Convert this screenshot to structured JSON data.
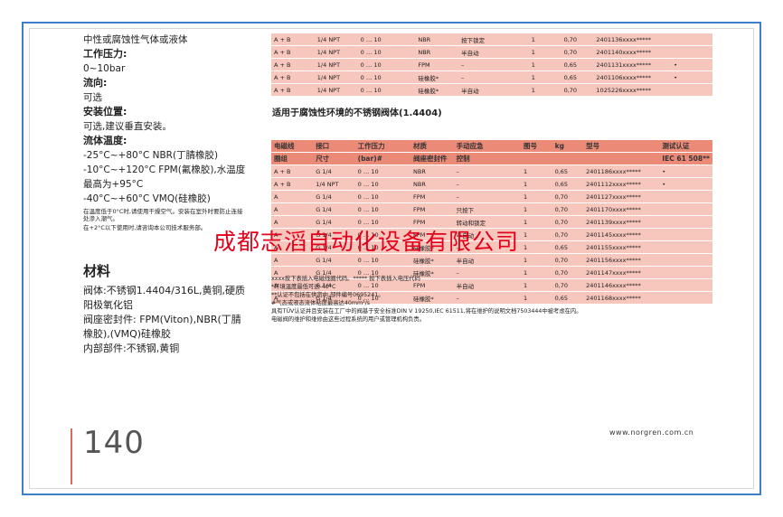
{
  "left": {
    "medium_tail": "中性或腐蚀性气体或液体",
    "pressure_label": "工作压力:",
    "pressure_value": "0~10bar",
    "flow_label": "流向:",
    "flow_value": "可选",
    "install_label": "安装位置:",
    "install_value": "可选,建议垂直安装。",
    "temp_label": "流体温度:",
    "temp_1": "-25°C~+80°C NBR(丁腈橡胶)",
    "temp_2": "-10°C~+120°C FPM(氟橡胶),水温度最高为+95°C",
    "temp_3": "-40°C~+60°C VMQ(硅橡胶)",
    "temp_note1": "在温度低于0°C时,请使用干燥空气。安装在室外时要防止连接处渗入潮气。",
    "temp_note2": "在+2°C以下使用时,请咨询本公司技术服务部。",
    "materials_title": "材料",
    "mat_1": "阀体:不锈钢1.4404/316L,黄铜,硬质阳极氧化铝",
    "mat_2": "阀座密封件: FPM(Viton),NBR(丁腈橡胶),(VMQ)硅橡胶",
    "mat_3": "内部部件:不锈钢,黄铜"
  },
  "table1": {
    "rows": [
      [
        "A + B",
        "1/4 NPT",
        "0 … 10",
        "NBR",
        "按下锁定",
        "1",
        "0,70",
        "2401136xxxx*****",
        ""
      ],
      [
        "A + B",
        "1/4 NPT",
        "0 … 10",
        "NBR",
        "半自动",
        "1",
        "0,70",
        "2401140xxxx*****",
        ""
      ],
      [
        "A + B",
        "1/4 NPT",
        "0 … 10",
        "FPM",
        "–",
        "1",
        "0,65",
        "2401131xxxx*****",
        "•"
      ],
      [
        "A + B",
        "1/4 NPT",
        "0 … 10",
        "硅橡胶*",
        "–",
        "1",
        "0,65",
        "2401106xxxx*****",
        "•"
      ],
      [
        "A + B",
        "1/4 NPT",
        "0 … 10",
        "硅橡胶*",
        "半自动",
        "1",
        "0,70",
        "1025226xxxx*****",
        ""
      ]
    ]
  },
  "section2_title": "适用于腐蚀性环境的不锈钢阀体(1.4404)",
  "table2": {
    "headers_line1": [
      "电磁线",
      "接口",
      "工作压力",
      "材质",
      "手动应急",
      "图号",
      "kg",
      "型号",
      "测试认证"
    ],
    "headers_line2": [
      "圈组",
      "尺寸",
      "(bar)#",
      "阀座密封件",
      "控制",
      "",
      "",
      "",
      "IEC 61 508**"
    ],
    "rows": [
      [
        "A + B",
        "G 1/4",
        "0 … 10",
        "NBR",
        "–",
        "1",
        "0,65",
        "2401186xxxx*****",
        "•"
      ],
      [
        "A + B",
        "1/4 NPT",
        "0 … 10",
        "NBR",
        "–",
        "1",
        "0,65",
        "2401112xxxx*****",
        "•"
      ],
      [
        "A",
        "G 1/4",
        "0 … 10",
        "FPM",
        "–",
        "1",
        "0,70",
        "2401127xxxx*****",
        ""
      ],
      [
        "A",
        "G 1/4",
        "0 … 10",
        "FPM",
        "只按下",
        "1",
        "0,70",
        "2401170xxxx*****",
        ""
      ],
      [
        "A",
        "G 1/4",
        "0 … 10",
        "FPM",
        "转动和锁定",
        "1",
        "0,70",
        "2401139xxxx*****",
        ""
      ],
      [
        "A",
        "G 1/4",
        "0 … 10",
        "FPM",
        "半自动",
        "1",
        "0,70",
        "2401145xxxx*****",
        ""
      ],
      [
        "A",
        "G 1/4",
        "0 … 10",
        "硅橡胶*",
        "–",
        "1",
        "0,65",
        "2401155xxxx*****",
        ""
      ],
      [
        "A",
        "G 1/4",
        "0 … 10",
        "硅橡胶*",
        "半自动",
        "1",
        "0,70",
        "2401156xxxx*****",
        ""
      ],
      [
        "A",
        "G 1/4",
        "0 … 10",
        "硅橡胶*",
        "–",
        "1",
        "0,70",
        "2401147xxxx*****",
        ""
      ],
      [
        "A",
        "G 1/4",
        "0 … 10",
        "FPM",
        "半自动",
        "1",
        "0,70",
        "2401146xxxx*****",
        ""
      ],
      [
        "A",
        "G 1/4",
        "0 … 10",
        "硅橡胶*",
        "–",
        "1",
        "0,65",
        "2401168xxxx*****",
        ""
      ]
    ]
  },
  "notes": [
    "xxxx按下表插入电磁线圈代码。***** 按下表插入电压代码",
    "*环境温度最低可达-40°C",
    "**认证不包括在供货中,部件编号0695241。",
    "#气态或液态流体粘度最高达40mm²/s",
    "具有TÜV认证并且安装在工厂中的阀基于安全标准DIN V 19250,IEC 61511,将在维护的说明文档7503444中被考虑在内。",
    "电磁阀的维护和维修由这些过程系统的用户或管理机构负责。"
  ],
  "watermark": "成都志滔自动化设备有限公司",
  "page_number": "140",
  "website": "www.norgren.com.cn",
  "colors": {
    "frame": "#3d7fc9",
    "table_header": "#ec8a78",
    "row": "#f7c6bd",
    "watermark": "#e3001b",
    "page_bar": "#d86b5c"
  }
}
